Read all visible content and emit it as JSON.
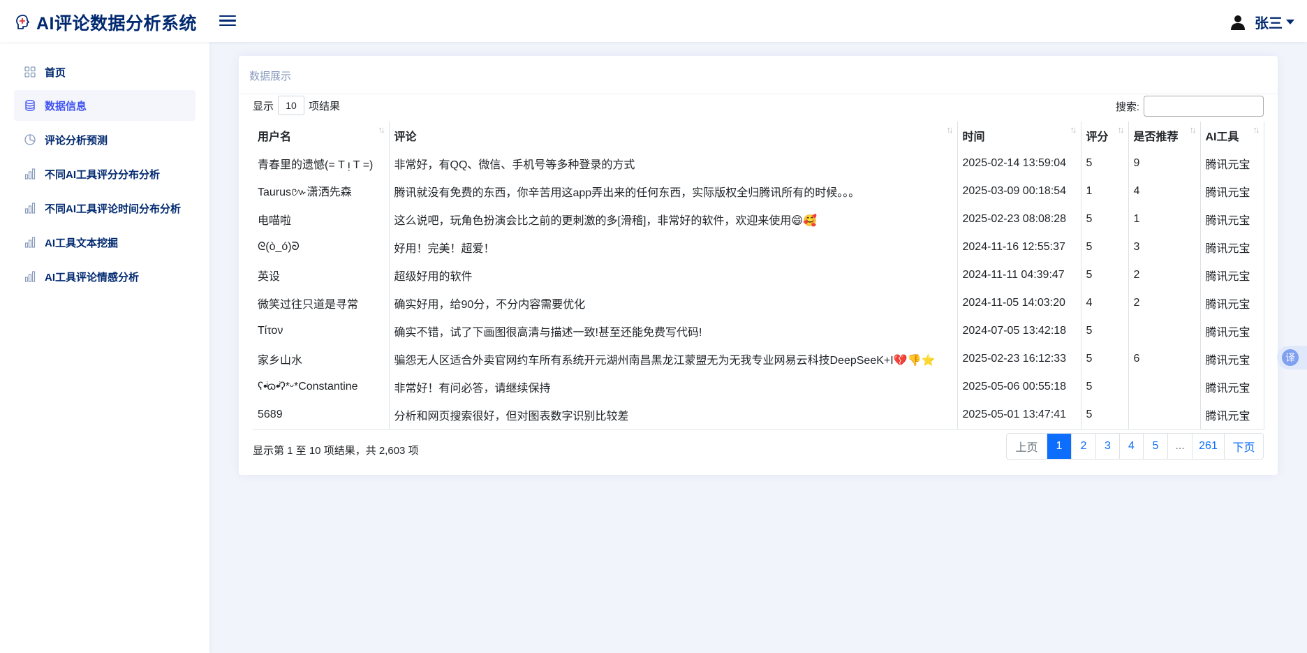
{
  "app": {
    "title": "AI评论数据分析系统"
  },
  "user": {
    "name": "张三"
  },
  "sidebar": {
    "items": [
      {
        "label": "首页",
        "icon": "grid-icon"
      },
      {
        "label": "数据信息",
        "icon": "database-icon",
        "active": true
      },
      {
        "label": "评论分析预测",
        "icon": "pie-chart-icon"
      },
      {
        "label": "不同AI工具评分分布分析",
        "icon": "bar-chart-icon"
      },
      {
        "label": "不同AI工具评论时间分布分析",
        "icon": "bar-chart-icon"
      },
      {
        "label": "AI工具文本挖掘",
        "icon": "bar-chart-icon"
      },
      {
        "label": "AI工具评论情感分析",
        "icon": "bar-chart-icon"
      }
    ]
  },
  "card": {
    "title": "数据展示"
  },
  "length": {
    "prefix": "显示",
    "value": "10",
    "suffix": "项结果"
  },
  "search": {
    "label": "搜索:",
    "value": ""
  },
  "table": {
    "columns": [
      "用户名",
      "评论",
      "时间",
      "评分",
      "是否推荐",
      "AI工具"
    ],
    "rows": [
      [
        "青春里的遗憾(= T ᴉ T =)",
        "非常好，有QQ、微信、手机号等多种登录的方式",
        "2025-02-14 13:59:04",
        "5",
        "9",
        "腾讯元宝"
      ],
      [
        "Taurus៚潇洒先森",
        "腾讯就没有免费的东西，你辛苦用这app弄出来的任何东西，实际版权全归腾讯所有的时候。。。",
        "2025-03-09 00:18:54",
        "1",
        "4",
        "腾讯元宝"
      ],
      [
        "电喵啦",
        "这么说吧，玩角色扮演会比之前的更刺激的多[滑稽]，非常好的软件，欢迎来使用😄🥰",
        "2025-02-23 08:08:28",
        "5",
        "1",
        "腾讯元宝"
      ],
      [
        "ᘓ(ò_ó)ᘐ",
        "好用！完美！超爱！",
        "2024-11-16 12:55:37",
        "5",
        "3",
        "腾讯元宝"
      ],
      [
        "英设",
        "超级好用的软件",
        "2024-11-11 04:39:47",
        "5",
        "2",
        "腾讯元宝"
      ],
      [
        "微笑过往只道是寻常",
        "确实好用，给90分，不分内容需要优化",
        "2024-11-05 14:03:20",
        "4",
        "2",
        "腾讯元宝"
      ],
      [
        "Tίτον",
        "确实不错，试了下画图很高清与描述一致!甚至还能免费写代码!",
        "2024-07-05 13:42:18",
        "5",
        "",
        "腾讯元宝"
      ],
      [
        "家乡山水",
        "骗怨无人区适合外卖官网约车所有系统开元湖州南昌黑龙江蒙盟无为无我专业网易云科技DeepSeeK+I💔👎⭐",
        "2025-02-23 16:12:33",
        "5",
        "6",
        "腾讯元宝"
      ],
      [
        "ʕ•ͥɷ•ͥʔ*ᵕ*Constantine",
        "非常好！有问必答，请继续保持",
        "2025-05-06 00:55:18",
        "5",
        "",
        "腾讯元宝"
      ],
      [
        "5689",
        "分析和网页搜索很好，但对图表数字识别比较差",
        "2025-05-01 13:47:41",
        "5",
        "",
        "腾讯元宝"
      ]
    ]
  },
  "info": {
    "text": "显示第 1 至 10 项结果，共 2,603 项"
  },
  "pagination": {
    "prev": "上页",
    "next": "下页",
    "pages": [
      "1",
      "2",
      "3",
      "4",
      "5",
      "...",
      "261"
    ],
    "active": "1"
  },
  "translate": {
    "label": "译"
  },
  "colors": {
    "brand": "#012970",
    "accent": "#4154f1",
    "primary": "#0d6efd"
  }
}
